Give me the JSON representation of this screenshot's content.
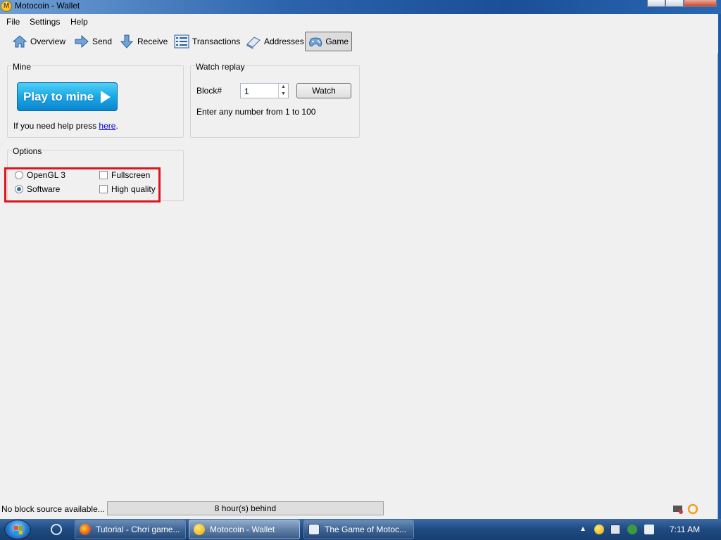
{
  "window": {
    "title": "Motocoin - Wallet",
    "app_icon_letter": "M"
  },
  "menubar": {
    "items": [
      "File",
      "Settings",
      "Help"
    ]
  },
  "toolbar": {
    "items": [
      {
        "id": "overview",
        "label": "Overview",
        "icon": "house-icon"
      },
      {
        "id": "send",
        "label": "Send",
        "icon": "arrow-right-icon"
      },
      {
        "id": "receive",
        "label": "Receive",
        "icon": "arrow-down-icon"
      },
      {
        "id": "transactions",
        "label": "Transactions",
        "icon": "list-icon"
      },
      {
        "id": "addresses",
        "label": "Addresses",
        "icon": "book-icon"
      },
      {
        "id": "game",
        "label": "Game",
        "icon": "gamepad-icon",
        "active": true
      }
    ]
  },
  "mine": {
    "title": "Mine",
    "play_button": "Play to mine",
    "help_prefix": "If you need help press ",
    "help_link": "here",
    "help_suffix": "."
  },
  "watch_replay": {
    "title": "Watch replay",
    "block_label": "Block#",
    "block_value": "1",
    "watch_button": "Watch",
    "hint": "Enter any number from 1 to 100"
  },
  "options": {
    "title": "Options",
    "opengl_label": "OpenGL 3",
    "software_label": "Software",
    "fullscreen_label": "Fullscreen",
    "high_quality_label": "High quality",
    "selected_renderer": "software",
    "fullscreen_checked": false,
    "high_quality_checked": false
  },
  "statusbar": {
    "text": "No block source available...",
    "progress_text": "8 hour(s) behind"
  },
  "taskbar": {
    "tasks": [
      {
        "id": "firefox",
        "label": "Tutorial - Chơi game..."
      },
      {
        "id": "wallet",
        "label": "Motocoin - Wallet",
        "active": true
      },
      {
        "id": "game",
        "label": "The Game of Motoc..."
      }
    ],
    "clock": "7:11 AM"
  },
  "colors": {
    "highlight": "#e0141e",
    "accent": "#1aa7e6",
    "link": "#0000cc"
  }
}
